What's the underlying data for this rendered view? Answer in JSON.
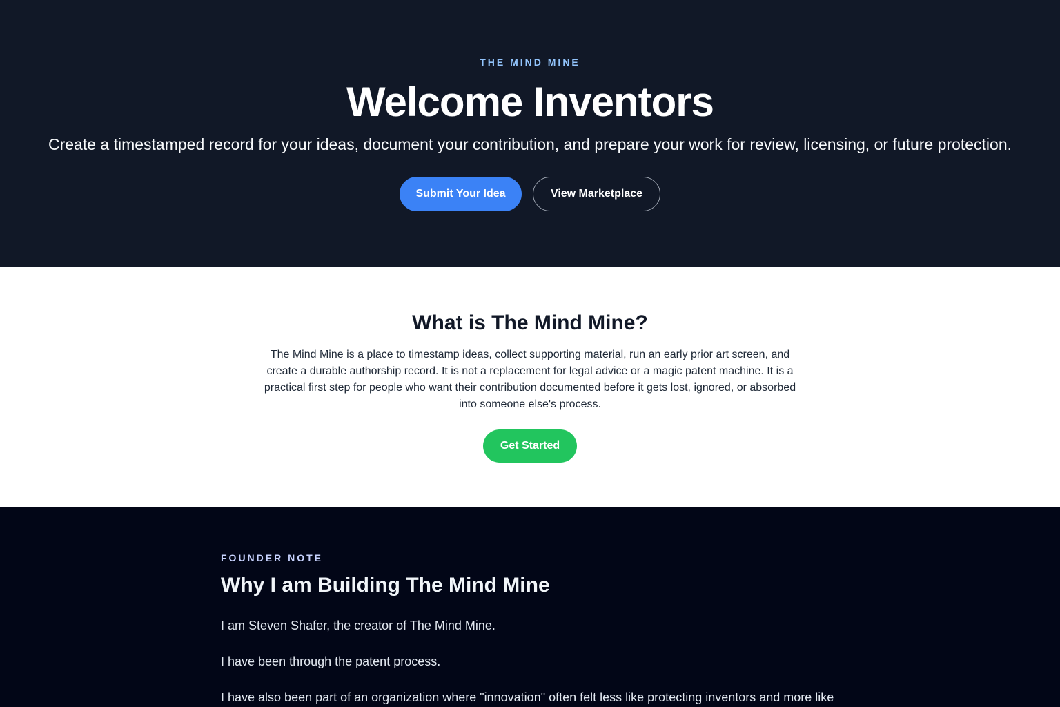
{
  "hero": {
    "eyebrow": "THE MIND MINE",
    "title": "Welcome Inventors",
    "subtitle": "Create a timestamped record for your ideas, document your contribution, and prepare your work for review, licensing, or future protection.",
    "primary_button": "Submit Your Idea",
    "secondary_button": "View Marketplace"
  },
  "about": {
    "title": "What is The Mind Mine?",
    "body": "The Mind Mine is a place to timestamp ideas, collect supporting material, run an early prior art screen, and create a durable authorship record. It is not a replacement for legal advice or a magic patent machine. It is a practical first step for people who want their contribution documented before it gets lost, ignored, or absorbed into someone else's process.",
    "button": "Get Started"
  },
  "founder": {
    "eyebrow": "FOUNDER NOTE",
    "title": "Why I am Building The Mind Mine",
    "paragraphs": [
      "I am Steven Shafer, the creator of The Mind Mine.",
      "I have been through the patent process.",
      "I have also been part of an organization where \"innovation\" often felt less like protecting inventors and more like"
    ]
  },
  "colors": {
    "hero_bg": "#111827",
    "primary": "#3b82f6",
    "success": "#22c55e",
    "founder_bg": "#020617"
  }
}
